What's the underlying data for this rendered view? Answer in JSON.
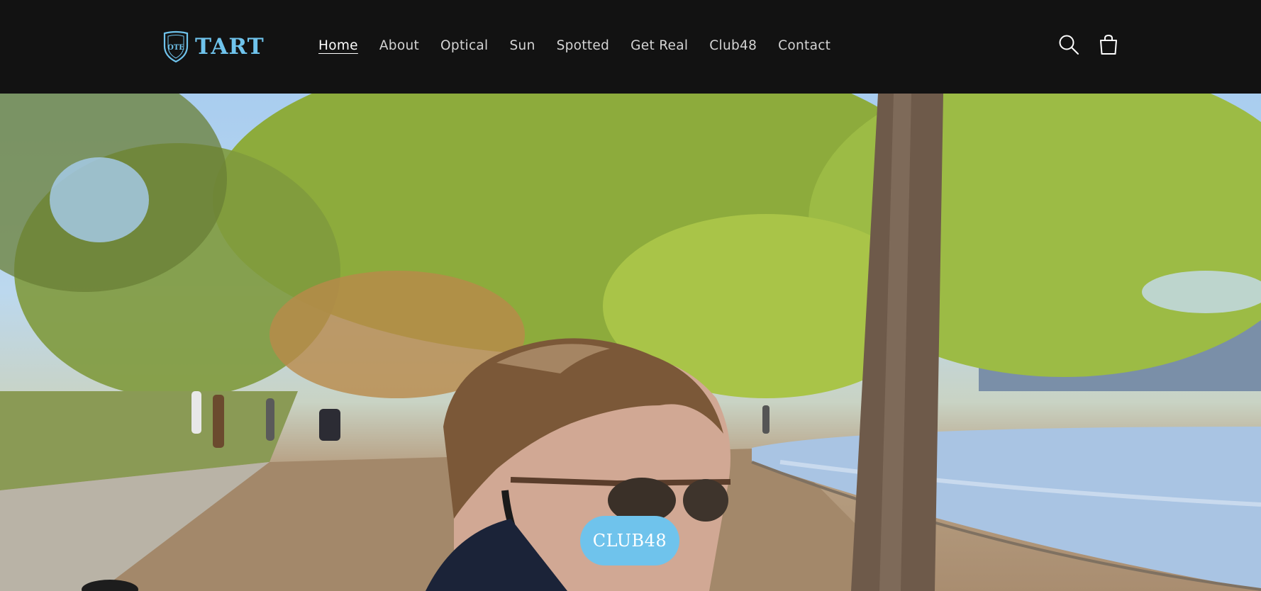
{
  "brand": {
    "logo_text": "TART",
    "logo_mark": "OTE"
  },
  "nav": {
    "items": [
      {
        "label": "Home",
        "active": true
      },
      {
        "label": "About",
        "active": false
      },
      {
        "label": "Optical",
        "active": false
      },
      {
        "label": "Sun",
        "active": false
      },
      {
        "label": "Spotted",
        "active": false
      },
      {
        "label": "Get Real",
        "active": false
      },
      {
        "label": "Club48",
        "active": false
      },
      {
        "label": "Contact",
        "active": false
      }
    ]
  },
  "header_icons": {
    "search": "search-icon",
    "cart": "cart-icon"
  },
  "hero": {
    "cta_label": "CLUB48"
  },
  "colors": {
    "header_bg": "#121212",
    "accent": "#6fc3ec",
    "nav_text": "#d4d4d4"
  }
}
